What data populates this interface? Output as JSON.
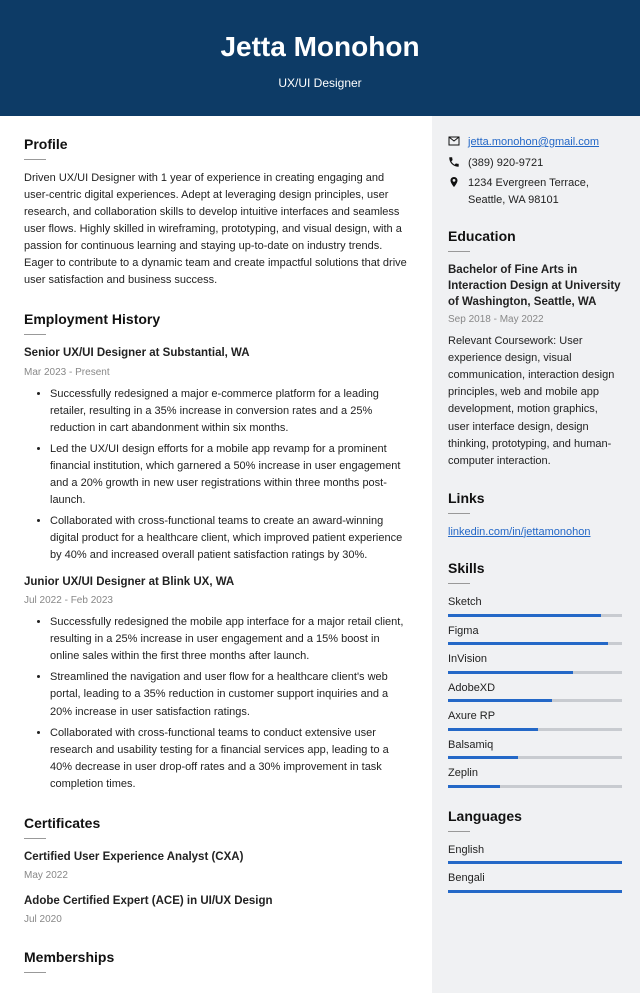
{
  "header": {
    "name": "Jetta Monohon",
    "title": "UX/UI Designer"
  },
  "profile": {
    "heading": "Profile",
    "text": "Driven UX/UI Designer with 1 year of experience in creating engaging and user-centric digital experiences. Adept at leveraging design principles, user research, and collaboration skills to develop intuitive interfaces and seamless user flows. Highly skilled in wireframing, prototyping, and visual design, with a passion for continuous learning and staying up-to-date on industry trends. Eager to contribute to a dynamic team and create impactful solutions that drive user satisfaction and business success."
  },
  "employment": {
    "heading": "Employment History",
    "jobs": [
      {
        "title": "Senior UX/UI Designer at Substantial, WA",
        "date": "Mar 2023 - Present",
        "bullets": [
          "Successfully redesigned a major e-commerce platform for a leading retailer, resulting in a 35% increase in conversion rates and a 25% reduction in cart abandonment within six months.",
          "Led the UX/UI design efforts for a mobile app revamp for a prominent financial institution, which garnered a 50% increase in user engagement and a 20% growth in new user registrations within three months post-launch.",
          "Collaborated with cross-functional teams to create an award-winning digital product for a healthcare client, which improved patient experience by 40% and increased overall patient satisfaction ratings by 30%."
        ]
      },
      {
        "title": "Junior UX/UI Designer at Blink UX, WA",
        "date": "Jul 2022 - Feb 2023",
        "bullets": [
          "Successfully redesigned the mobile app interface for a major retail client, resulting in a 25% increase in user engagement and a 15% boost in online sales within the first three months after launch.",
          "Streamlined the navigation and user flow for a healthcare client's web portal, leading to a 35% reduction in customer support inquiries and a 20% increase in user satisfaction ratings.",
          "Collaborated with cross-functional teams to conduct extensive user research and usability testing for a financial services app, leading to a 40% decrease in user drop-off rates and a 30% improvement in task completion times."
        ]
      }
    ]
  },
  "certificates": {
    "heading": "Certificates",
    "items": [
      {
        "title": "Certified User Experience Analyst (CXA)",
        "date": "May 2022"
      },
      {
        "title": "Adobe Certified Expert (ACE) in UI/UX Design",
        "date": "Jul 2020"
      }
    ]
  },
  "memberships": {
    "heading": "Memberships"
  },
  "contact": {
    "email": "jetta.monohon@gmail.com",
    "phone": "(389) 920-9721",
    "address": "1234 Evergreen Terrace, Seattle, WA 98101"
  },
  "education": {
    "heading": "Education",
    "title": "Bachelor of Fine Arts in Interaction Design at University of Washington, Seattle, WA",
    "date": "Sep 2018 - May 2022",
    "text": "Relevant Coursework: User experience design, visual communication, interaction design principles, web and mobile app development, motion graphics, user interface design, design thinking, prototyping, and human-computer interaction."
  },
  "links": {
    "heading": "Links",
    "url": "linkedin.com/in/jettamonohon"
  },
  "skills": {
    "heading": "Skills",
    "items": [
      {
        "name": "Sketch",
        "pct": 88
      },
      {
        "name": "Figma",
        "pct": 92
      },
      {
        "name": "InVision",
        "pct": 72
      },
      {
        "name": "AdobeXD",
        "pct": 60
      },
      {
        "name": "Axure RP",
        "pct": 52
      },
      {
        "name": "Balsamiq",
        "pct": 40
      },
      {
        "name": "Zeplin",
        "pct": 30
      }
    ]
  },
  "languages": {
    "heading": "Languages",
    "items": [
      {
        "name": "English",
        "pct": 100
      },
      {
        "name": "Bengali",
        "pct": 100
      }
    ]
  }
}
